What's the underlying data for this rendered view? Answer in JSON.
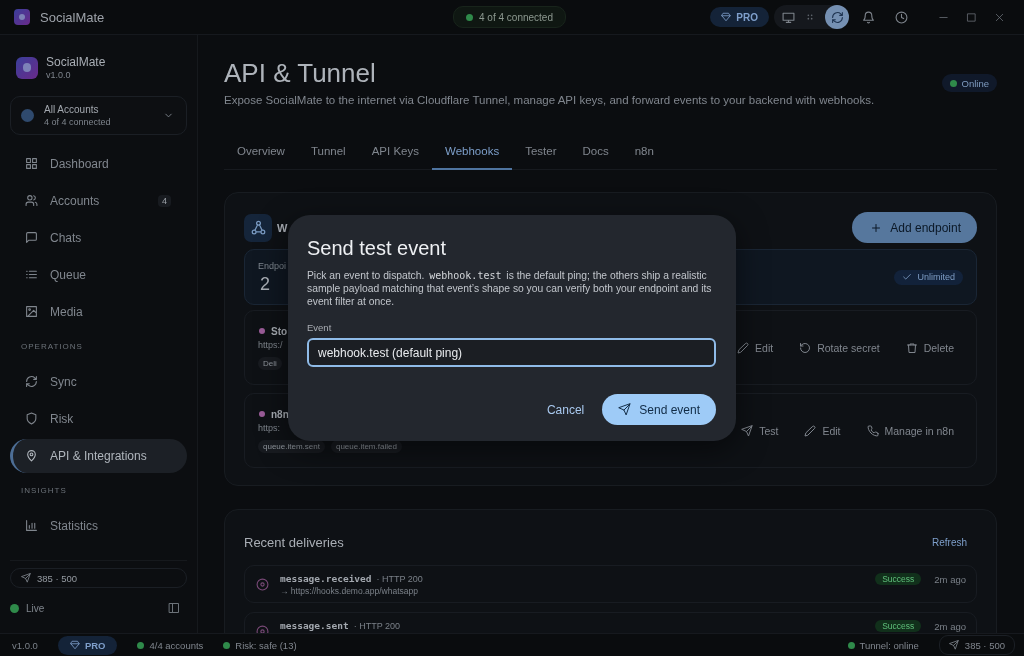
{
  "title_bar": {
    "app_name": "SocialMate",
    "connection": "4 of 4 connected",
    "plan": "PRO"
  },
  "sidebar": {
    "app_name": "SocialMate",
    "version": "v1.0.0",
    "account_switcher": {
      "title": "All Accounts",
      "subtitle": "4 of 4 connected"
    },
    "nav": [
      {
        "kind": "item",
        "label": "Dashboard",
        "selected": false
      },
      {
        "kind": "item",
        "label": "Accounts",
        "badge": "4",
        "selected": false
      },
      {
        "kind": "item",
        "label": "Chats",
        "selected": false
      },
      {
        "kind": "item",
        "label": "Queue",
        "selected": false
      },
      {
        "kind": "item",
        "label": "Media",
        "selected": false
      },
      {
        "kind": "heading",
        "label": "OPERATIONS"
      },
      {
        "kind": "item",
        "label": "Sync",
        "selected": false
      },
      {
        "kind": "item",
        "label": "Risk",
        "selected": false
      },
      {
        "kind": "item",
        "label": "API & Integrations",
        "selected": true
      },
      {
        "kind": "heading",
        "label": "INSIGHTS"
      },
      {
        "kind": "item",
        "label": "Statistics",
        "selected": false
      }
    ],
    "quota": "385 · 500",
    "live": "Live"
  },
  "page": {
    "title": "API & Tunnel",
    "subtitle": "Expose SocialMate to the internet via Cloudflare Tunnel, manage API keys, and forward events to your backend with webhooks.",
    "status": "Online"
  },
  "tabs": [
    {
      "label": "Overview",
      "selected": false
    },
    {
      "label": "Tunnel",
      "selected": false
    },
    {
      "label": "API Keys",
      "selected": false
    },
    {
      "label": "Webhooks",
      "selected": true
    },
    {
      "label": "Tester",
      "selected": false
    },
    {
      "label": "Docs",
      "selected": false
    },
    {
      "label": "n8n",
      "selected": false
    }
  ],
  "webhooks": {
    "title": "W",
    "add_button": "Add endpoint",
    "stats": {
      "label": "Endpoi",
      "value": "2",
      "badge": "Unlimited"
    },
    "endpoints": [
      {
        "name": "Sto",
        "url": "https:/",
        "color": "#9a5c98",
        "events": [
          "Deli"
        ],
        "actions": [
          {
            "kind": "edit",
            "label": "Edit"
          },
          {
            "kind": "rotate",
            "label": "Rotate secret"
          },
          {
            "kind": "delete",
            "label": "Delete"
          }
        ]
      },
      {
        "name": "n8n",
        "url": "https:",
        "color": "#9a5c98",
        "events": [
          "queue.item.sent",
          "queue.item.failed"
        ],
        "actions": [
          {
            "kind": "test",
            "label": "Test"
          },
          {
            "kind": "edit",
            "label": "Edit"
          },
          {
            "kind": "manage",
            "label": "Manage in n8n"
          }
        ]
      }
    ]
  },
  "deliveries": {
    "title": "Recent deliveries",
    "refresh": "Refresh",
    "rows": [
      {
        "event": "message.received",
        "code": "· HTTP 200",
        "target": "→ https://hooks.demo.app/whatsapp",
        "result": "Success",
        "time": "2m ago"
      },
      {
        "event": "message.sent",
        "code": "· HTTP 200",
        "result": "Success",
        "time": "2m ago"
      }
    ]
  },
  "status_bar": {
    "left": [
      {
        "kind": "version",
        "label": "v1.0.0"
      },
      {
        "kind": "plan",
        "label": "PRO"
      },
      {
        "kind": "status",
        "label": "4/4 accounts"
      },
      {
        "kind": "status",
        "label": "Risk: safe (13)"
      }
    ],
    "right": [
      {
        "kind": "status",
        "label": "Tunnel: online"
      },
      {
        "kind": "quota",
        "label": "385 · 500"
      }
    ]
  },
  "dialog": {
    "title": "Send test event",
    "description": [
      {
        "kind": "text",
        "text": "Pick an event to dispatch."
      },
      {
        "kind": "code",
        "text": "webhook.test"
      },
      {
        "kind": "text",
        "text": "is the default ping; the others ship a realistic sample payload matching that event’s shape so you can verify both your endpoint and its event filter at once."
      }
    ],
    "field": {
      "label": "Event",
      "value": "webhook.test (default ping)"
    },
    "buttons": [
      {
        "kind": "text",
        "label": "Cancel"
      },
      {
        "kind": "primary",
        "label": "Send event"
      }
    ]
  }
}
